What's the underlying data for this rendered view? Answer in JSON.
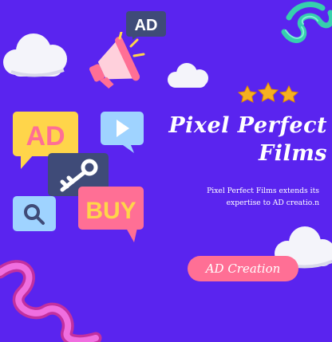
{
  "title": {
    "line1": "Pixel Perfect",
    "line2": "Films"
  },
  "description": "Pixel Perfect Films extends its expertise to AD creatio.n",
  "cta": {
    "label": "AD Creation"
  },
  "badges": {
    "megaphone_ad": "AD",
    "bubble_ad": "AD",
    "bubble_buy": "BUY"
  },
  "rating": {
    "stars": 3
  },
  "colors": {
    "background": "#5a24ef",
    "button": "#ff6f95",
    "star": "#f5b021",
    "bubble_yellow": "#ffd54a",
    "bubble_blue": "#9fd3ff",
    "bubble_pink": "#ff6f95",
    "bubble_navy": "#3f4b78",
    "cloud": "#f4f4fa",
    "spiral_teal": "#3fd7b6",
    "ribbon_pink": "#e34cc8"
  },
  "icons": [
    "cloud-icon",
    "megaphone-icon",
    "star-icon",
    "play-icon",
    "key-icon",
    "search-icon",
    "spiral-decoration",
    "ribbon-decoration"
  ]
}
